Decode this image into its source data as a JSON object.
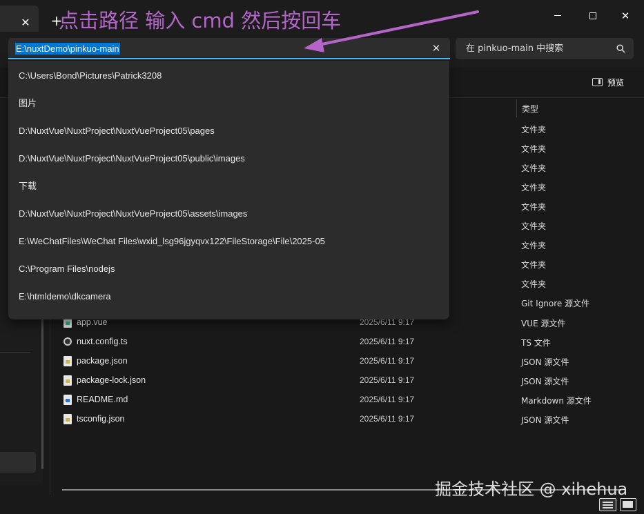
{
  "titlebar": {
    "tab_close": "✕",
    "new_tab": "+",
    "annotation": "点击路径 输入 cmd 然后按回车",
    "minimize_icon": "minimize-icon",
    "maximize_icon": "maximize-icon",
    "close": "✕"
  },
  "address": {
    "value": "E:\\nuxtDemo\\pinkuo-main",
    "clear": "✕"
  },
  "search": {
    "placeholder": "在 pinkuo-main 中搜索",
    "icon": "search-icon"
  },
  "commandbar": {
    "preview_label": "预览"
  },
  "suggestions": [
    "C:\\Users\\Bond\\Pictures\\Patrick3208",
    "图片",
    "D:\\NuxtVue\\NuxtProject\\NuxtVueProject05\\pages",
    "D:\\NuxtVue\\NuxtProject\\NuxtVueProject05\\public\\images",
    "下载",
    "D:\\NuxtVue\\NuxtProject\\NuxtVueProject05\\assets\\images",
    "E:\\WeChatFiles\\WeChat Files\\wxid_lsg96jgyqvx122\\FileStorage\\File\\2025-05",
    "C:\\Program Files\\nodejs",
    "E:\\htmldemo\\dkcamera"
  ],
  "file_list": {
    "type_header": "类型",
    "hidden_types": [
      "文件夹",
      "文件夹",
      "文件夹",
      "文件夹",
      "文件夹",
      "文件夹",
      "文件夹",
      "文件夹",
      "文件夹",
      "Git Ignore 源文件"
    ],
    "rows": [
      {
        "name": "app.vue",
        "date": "2025/6/11 9:17",
        "type": "VUE 源文件",
        "icon": "vue"
      },
      {
        "name": "nuxt.config.ts",
        "date": "2025/6/11 9:17",
        "type": "TS 文件",
        "icon": "ts"
      },
      {
        "name": "package.json",
        "date": "2025/6/11 9:17",
        "type": "JSON 源文件",
        "icon": "json"
      },
      {
        "name": "package-lock.json",
        "date": "2025/6/11 9:17",
        "type": "JSON 源文件",
        "icon": "json"
      },
      {
        "name": "README.md",
        "date": "2025/6/11 9:17",
        "type": "Markdown 源文件",
        "icon": "md"
      },
      {
        "name": "tsconfig.json",
        "date": "2025/6/11 9:17",
        "type": "JSON 源文件",
        "icon": "json"
      }
    ]
  },
  "watermark": "掘金技术社区 @ xihehua",
  "colors": {
    "annotation": "#b565c9",
    "selection": "#0078d4",
    "focus_underline": "#4cc2ff"
  }
}
